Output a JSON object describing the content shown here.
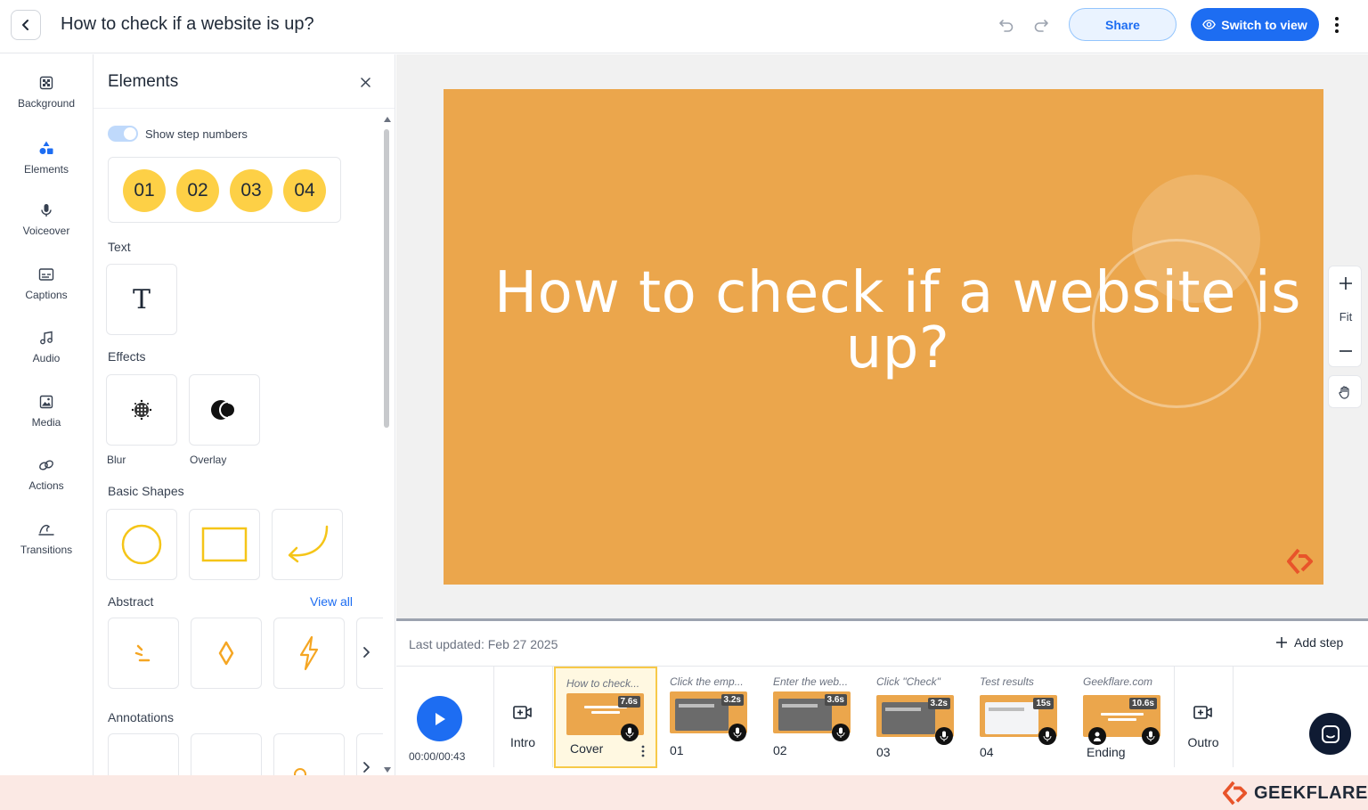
{
  "header": {
    "title": "How to check if a website is up?",
    "share_label": "Share",
    "switch_label": "Switch to view"
  },
  "rail": {
    "items": [
      {
        "label": "Background",
        "icon": "background-icon"
      },
      {
        "label": "Elements",
        "icon": "elements-icon"
      },
      {
        "label": "Voiceover",
        "icon": "microphone-icon"
      },
      {
        "label": "Captions",
        "icon": "captions-icon"
      },
      {
        "label": "Audio",
        "icon": "music-icon"
      },
      {
        "label": "Media",
        "icon": "image-icon"
      },
      {
        "label": "Actions",
        "icon": "link-icon"
      },
      {
        "label": "Transitions",
        "icon": "transitions-icon"
      }
    ]
  },
  "panel": {
    "title": "Elements",
    "toggle_label": "Show step numbers",
    "step_numbers": [
      "01",
      "02",
      "03",
      "04"
    ],
    "text_label": "Text",
    "text_tile_glyph": "T",
    "effects_label": "Effects",
    "effects": [
      "Blur",
      "Overlay"
    ],
    "basic_shapes_label": "Basic Shapes",
    "abstract_label": "Abstract",
    "view_all_label": "View all",
    "annotations_label": "Annotations"
  },
  "slide": {
    "title": "How to check if a website is up?"
  },
  "zoom": {
    "fit_label": "Fit"
  },
  "timeline": {
    "last_updated": "Last updated: Feb 27 2025",
    "add_step_label": "Add step",
    "time": "00:00/00:43",
    "intro_label": "Intro",
    "outro_label": "Outro",
    "steps": [
      {
        "title": "How to check...",
        "duration": "7.6s",
        "label": "Cover"
      },
      {
        "title": "Click the emp...",
        "duration": "3.2s",
        "label": "01"
      },
      {
        "title": "Enter the web...",
        "duration": "3.6s",
        "label": "02"
      },
      {
        "title": "Click \"Check\"",
        "duration": "3.2s",
        "label": "03"
      },
      {
        "title": "Test results",
        "duration": "15s",
        "label": "04"
      },
      {
        "title": "Geekflare.com",
        "duration": "10.6s",
        "label": "Ending"
      }
    ]
  },
  "footer": {
    "brand": "GEEKFLARE"
  },
  "colors": {
    "accent": "#1d6df2",
    "slide_bg": "#eba64c",
    "step_yellow": "#fdd046",
    "shape_yellow": "#f5c518"
  }
}
